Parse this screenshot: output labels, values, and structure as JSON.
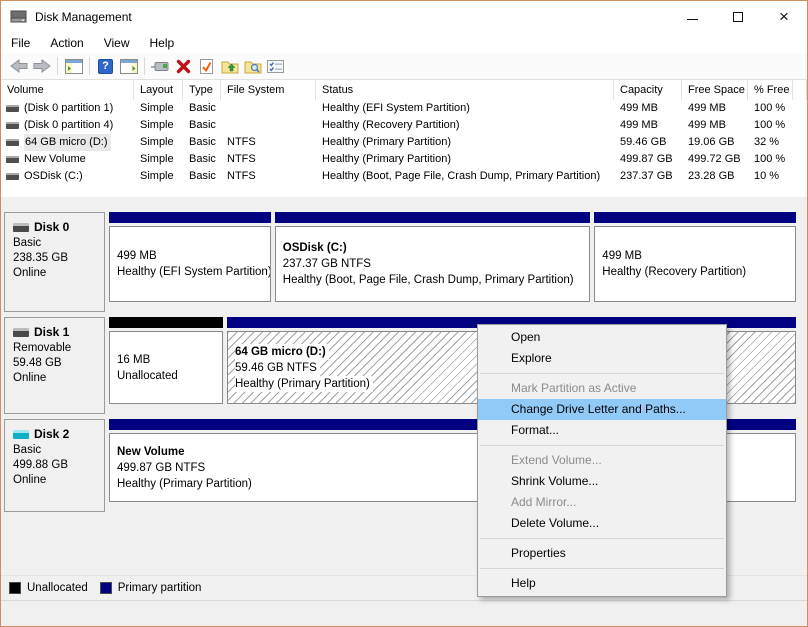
{
  "colors": {
    "accent_border": "#d18d60",
    "primary_partition": "#000080",
    "unallocated": "#000000",
    "menu_highlight": "#91c9f7"
  },
  "window": {
    "title": "Disk Management"
  },
  "menu_bar": {
    "items": [
      "File",
      "Action",
      "View",
      "Help"
    ]
  },
  "toolbar": {
    "icons": [
      "back",
      "forward",
      "console-tree",
      "help",
      "action-pane",
      "disk-view",
      "delete",
      "commit-check",
      "open-folder",
      "explore-folder",
      "properties"
    ]
  },
  "volume_table": {
    "columns": [
      "Volume",
      "Layout",
      "Type",
      "File System",
      "Status",
      "Capacity",
      "Free Space",
      "% Free"
    ],
    "rows": [
      {
        "volume": "(Disk 0 partition 1)",
        "layout": "Simple",
        "type": "Basic",
        "file_system": "",
        "status": "Healthy (EFI System Partition)",
        "capacity": "499 MB",
        "free_space": "499 MB",
        "pct_free": "100 %"
      },
      {
        "volume": "(Disk 0 partition 4)",
        "layout": "Simple",
        "type": "Basic",
        "file_system": "",
        "status": "Healthy (Recovery Partition)",
        "capacity": "499 MB",
        "free_space": "499 MB",
        "pct_free": "100 %"
      },
      {
        "volume": "64 GB micro (D:)",
        "layout": "Simple",
        "type": "Basic",
        "file_system": "NTFS",
        "status": "Healthy (Primary Partition)",
        "capacity": "59.46 GB",
        "free_space": "19.06 GB",
        "pct_free": "32 %"
      },
      {
        "volume": "New Volume",
        "layout": "Simple",
        "type": "Basic",
        "file_system": "NTFS",
        "status": "Healthy (Primary Partition)",
        "capacity": "499.87 GB",
        "free_space": "499.72 GB",
        "pct_free": "100 %"
      },
      {
        "volume": "OSDisk (C:)",
        "layout": "Simple",
        "type": "Basic",
        "file_system": "NTFS",
        "status": "Healthy (Boot, Page File, Crash Dump, Primary Partition)",
        "capacity": "237.37 GB",
        "free_space": "23.28 GB",
        "pct_free": "10 %"
      }
    ]
  },
  "disks": [
    {
      "name": "Disk 0",
      "kind": "Basic",
      "size": "238.35 GB",
      "state": "Online",
      "partitions": [
        {
          "title": "",
          "line1": "499 MB",
          "line2": "Healthy (EFI System Partition)"
        },
        {
          "title": "OSDisk (C:)",
          "line1": "237.37 GB NTFS",
          "line2": "Healthy (Boot, Page File, Crash Dump, Primary Partition)"
        },
        {
          "title": "",
          "line1": "499 MB",
          "line2": "Healthy (Recovery Partition)"
        }
      ]
    },
    {
      "name": "Disk 1",
      "kind": "Removable",
      "size": "59.48 GB",
      "state": "Online",
      "partitions": [
        {
          "title": "",
          "line1": "16 MB",
          "line2": "Unallocated"
        },
        {
          "title": "64 GB micro (D:)",
          "line1": "59.46 GB NTFS",
          "line2": "Healthy (Primary Partition)"
        }
      ]
    },
    {
      "name": "Disk 2",
      "kind": "Basic",
      "size": "499.88 GB",
      "state": "Online",
      "partitions": [
        {
          "title": "New Volume",
          "line1": "499.87 GB NTFS",
          "line2": "Healthy (Primary Partition)"
        }
      ]
    }
  ],
  "context_menu": {
    "items": [
      {
        "label": "Open",
        "state": "normal"
      },
      {
        "label": "Explore",
        "state": "normal"
      },
      {
        "label": "",
        "state": "separator"
      },
      {
        "label": "Mark Partition as Active",
        "state": "disabled"
      },
      {
        "label": "Change Drive Letter and Paths...",
        "state": "highlighted"
      },
      {
        "label": "Format...",
        "state": "normal"
      },
      {
        "label": "",
        "state": "separator"
      },
      {
        "label": "Extend Volume...",
        "state": "disabled"
      },
      {
        "label": "Shrink Volume...",
        "state": "normal"
      },
      {
        "label": "Add Mirror...",
        "state": "disabled"
      },
      {
        "label": "Delete Volume...",
        "state": "normal"
      },
      {
        "label": "",
        "state": "separator"
      },
      {
        "label": "Properties",
        "state": "normal"
      },
      {
        "label": "",
        "state": "separator"
      },
      {
        "label": "Help",
        "state": "normal"
      }
    ]
  },
  "legend": {
    "items": [
      {
        "label": "Unallocated",
        "color": "#000000"
      },
      {
        "label": "Primary partition",
        "color": "#000080"
      }
    ]
  }
}
